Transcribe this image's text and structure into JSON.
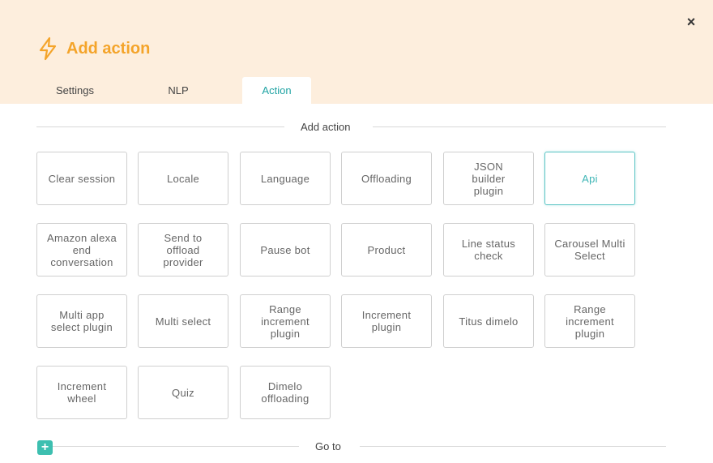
{
  "dialog": {
    "title": "Add action",
    "close_label": "×"
  },
  "tabs": [
    {
      "label": "Settings"
    },
    {
      "label": "NLP"
    },
    {
      "label": "Action"
    }
  ],
  "add_action_section": {
    "label": "Add action"
  },
  "actions": [
    {
      "label": "Clear session"
    },
    {
      "label": "Locale"
    },
    {
      "label": "Language"
    },
    {
      "label": "Offloading"
    },
    {
      "label": "JSON builder plugin"
    },
    {
      "label": "Api"
    },
    {
      "label": "Amazon alexa end conversation"
    },
    {
      "label": "Send to offload provider"
    },
    {
      "label": "Pause bot"
    },
    {
      "label": "Product"
    },
    {
      "label": "Line status check"
    },
    {
      "label": "Carousel Multi Select"
    },
    {
      "label": "Multi app select plugin"
    },
    {
      "label": "Multi select"
    },
    {
      "label": "Range increment plugin"
    },
    {
      "label": "Increment plugin"
    },
    {
      "label": "Titus dimelo"
    },
    {
      "label": "Range increment plugin"
    },
    {
      "label": "Increment wheel"
    },
    {
      "label": "Quiz"
    },
    {
      "label": "Dimelo offloading"
    }
  ],
  "goto_section": {
    "label": "Go to",
    "add_label": "+"
  },
  "colors": {
    "header_bg": "#fdeedd",
    "accent_orange": "#f4a42a",
    "accent_teal": "#1fa3a3"
  }
}
